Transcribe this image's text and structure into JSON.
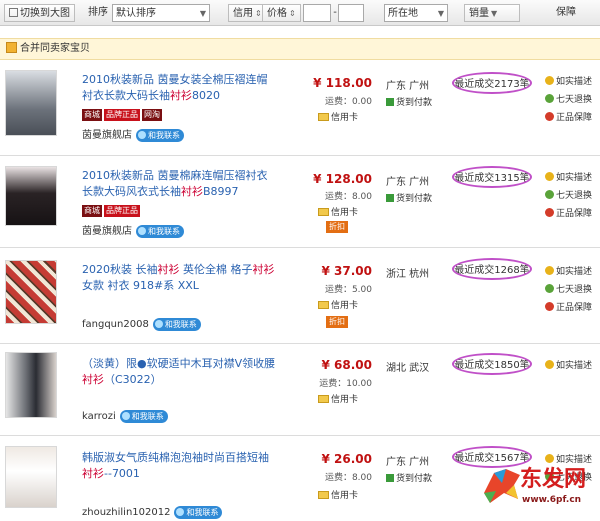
{
  "toolbar": {
    "switch_label": "切换到大图",
    "sort_label": "排序",
    "sort_value": "默认排序",
    "credit_label": "信用",
    "price_label": "价格",
    "location_value": "所在地",
    "sales_label": "销量",
    "guarantee_label": "保障"
  },
  "notice": {
    "text": "合并同卖家宝贝"
  },
  "items": [
    {
      "title_a": "2010秋装新品 茵曼女装全棉压褶连帽",
      "title_b": "衬衣长款大码长袖",
      "title_hl": "衬衫",
      "title_c": "8020",
      "badges": [
        "商城",
        "品牌正品",
        "网淘"
      ],
      "seller": "茵曼旗舰店",
      "contact": "和我联系",
      "price": "¥ 118.00",
      "shipping": "运费：0.00",
      "card": "信用卡",
      "discount": "",
      "location": "广东 广州",
      "cod": "货到付款",
      "sales": "最近成交2173笔",
      "services": [
        "如实描述",
        "七天退换",
        "正品保障"
      ]
    },
    {
      "title_a": "2010秋装新品 茵曼棉麻连帽压褶衬衣",
      "title_b": "长款大码风衣式长袖",
      "title_hl": "衬衫",
      "title_c": "B8997",
      "badges": [
        "商城",
        "品牌正品"
      ],
      "seller": "茵曼旗舰店",
      "contact": "和我联系",
      "price": "¥ 128.00",
      "shipping": "运费：8.00",
      "card": "信用卡",
      "discount": "折扣",
      "location": "广东 广州",
      "cod": "货到付款",
      "sales": "最近成交1315笔",
      "services": [
        "如实描述",
        "七天退换",
        "正品保障"
      ]
    },
    {
      "title_a": "2020秋装 长袖",
      "title_hl": "衬衫",
      "title_b": " 英伦全棉 格子",
      "title_c": "衬衫",
      "title_d": "女款 衬衣 918#系 XXL",
      "badges": [],
      "seller": "fangqun2008",
      "contact": "和我联系",
      "price": "¥ 37.00",
      "shipping": "运费：5.00",
      "card": "信用卡",
      "discount": "折扣",
      "location": "浙江 杭州",
      "cod": "",
      "sales": "最近成交1268笔",
      "services": [
        "如实描述",
        "七天退换",
        "正品保障"
      ]
    },
    {
      "title_a": "（淡黄）限●软硬适中木耳对襟V领收腰",
      "title_hl": "衬衫",
      "title_b": "（C3022）",
      "badges": [],
      "seller": "karrozi",
      "contact": "和我联系",
      "price": "¥ 68.00",
      "shipping": "运费：10.00",
      "card": "信用卡",
      "discount": "",
      "location": "湖北 武汉",
      "cod": "",
      "sales": "最近成交1850笔",
      "services": [
        "如实描述"
      ]
    },
    {
      "title_a": "韩版淑女气质纯棉泡泡袖时尚百搭短袖",
      "title_hl": "衬衫",
      "title_b": "--7001",
      "badges": [],
      "seller": "zhouzhilin102012",
      "contact": "和我联系",
      "price": "¥ 26.00",
      "shipping": "运费：8.00",
      "card": "信用卡",
      "discount": "",
      "location": "广东 广州",
      "cod": "货到付款",
      "sales": "最近成交1567笔",
      "services": [
        "如实描述",
        "七天退换"
      ]
    }
  ],
  "watermark": {
    "text": "东发网",
    "url": "www.6pf.cn"
  },
  "colors": {
    "price": "#c01111",
    "link": "#2a62b0",
    "highlight": "#c040c0"
  }
}
